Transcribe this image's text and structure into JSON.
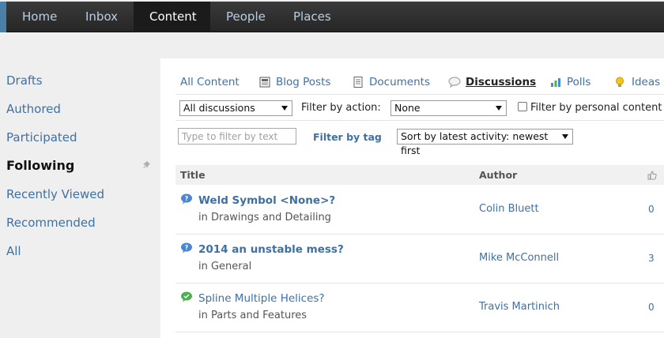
{
  "topnav": {
    "items": [
      {
        "label": "Home"
      },
      {
        "label": "Inbox"
      },
      {
        "label": "Content"
      },
      {
        "label": "People"
      },
      {
        "label": "Places"
      }
    ],
    "active": "Content",
    "colors": {
      "bar": "#2e2e2e",
      "active": "#1b1b1b",
      "link": "#b9cfe2",
      "accent": "#4a7fa8"
    }
  },
  "sidebar": {
    "items": [
      {
        "label": "Drafts"
      },
      {
        "label": "Authored"
      },
      {
        "label": "Participated"
      },
      {
        "label": "Following"
      },
      {
        "label": "Recently Viewed"
      },
      {
        "label": "Recommended"
      },
      {
        "label": "All"
      }
    ],
    "selected": "Following"
  },
  "tabs": [
    {
      "label": "All Content",
      "icon": null
    },
    {
      "label": "Blog Posts",
      "icon": "blog-icon"
    },
    {
      "label": "Documents",
      "icon": "document-icon"
    },
    {
      "label": "Discussions",
      "icon": "speech-bubble-icon"
    },
    {
      "label": "Polls",
      "icon": "bar-chart-icon"
    },
    {
      "label": "Ideas",
      "icon": "lightbulb-icon"
    }
  ],
  "active_tab": "Discussions",
  "filters": {
    "type_value": "All discussions",
    "action_label": "Filter by action:",
    "action_value": "None",
    "personal_label": "Filter by personal content",
    "text_placeholder": "Type to filter by text",
    "tag_label": "Filter by tag",
    "sort_value": "Sort by latest activity: newest first"
  },
  "table": {
    "columns": {
      "title": "Title",
      "author": "Author",
      "likes_icon": "thumbs-up-icon"
    },
    "rows": [
      {
        "title": "Weld Symbol <None>?",
        "place": "in Drawings and Detailing",
        "author": "Colin Bluett",
        "count": "0",
        "status": "question",
        "bold": true
      },
      {
        "title": "2014 an unstable mess?",
        "place": "in General",
        "author": "Mike McConnell",
        "count": "3",
        "status": "question",
        "bold": true
      },
      {
        "title": "Spline Multiple Helices?",
        "place": "in Parts and Features",
        "author": "Travis Martinich",
        "count": "0",
        "status": "answered",
        "bold": false
      }
    ]
  },
  "colors": {
    "link": "#3f70a3",
    "question_icon": "#4a86d4",
    "answered_icon": "#4caf50"
  }
}
